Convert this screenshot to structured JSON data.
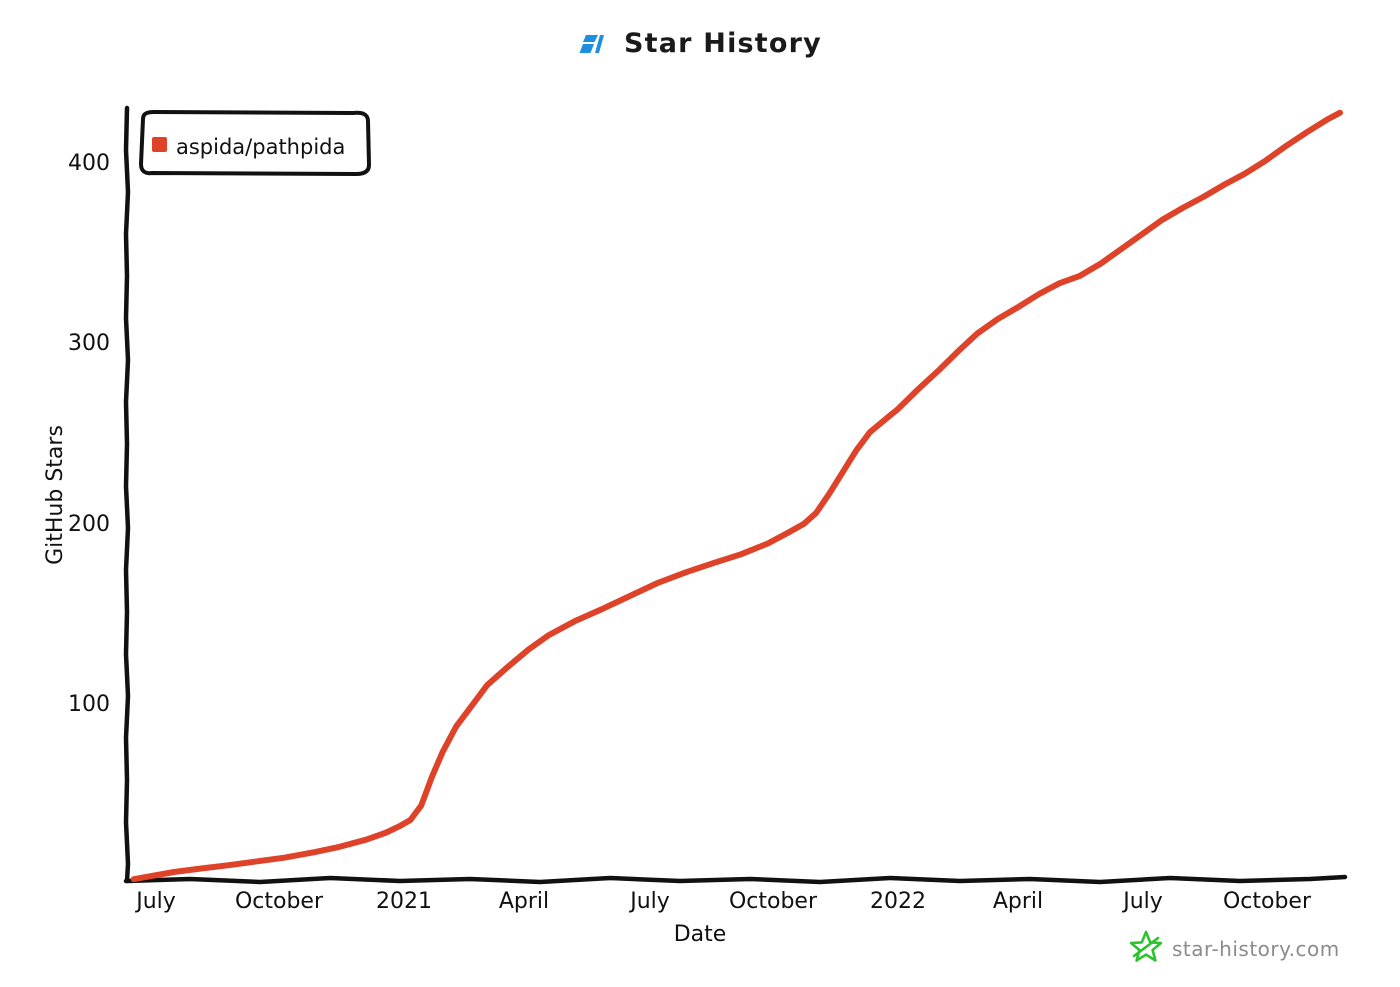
{
  "header": {
    "logo_icon": "star-history-logo-icon",
    "logo_color": "#1D8FE1",
    "title": "Star History"
  },
  "watermark": {
    "star_icon": "green-star-icon",
    "star_color": "#2EC22E",
    "text": "star-history.com"
  },
  "legend": {
    "position": "top-left",
    "entries": [
      {
        "label": "aspida/pathpida",
        "color": "#DE432A",
        "marker": "square"
      }
    ]
  },
  "chart_data": {
    "type": "line",
    "title": "Star History",
    "xlabel": "Date",
    "ylabel": "GitHub Stars",
    "grid": false,
    "xticks": [
      "July",
      "October",
      "2021",
      "April",
      "July",
      "October",
      "2022",
      "April",
      "July",
      "October"
    ],
    "yticks": [
      100,
      200,
      300,
      400
    ],
    "ylim": [
      0,
      440
    ],
    "xlim": [
      "2020-06-15",
      "2022-12-05"
    ],
    "series": [
      {
        "name": "aspida/pathpida",
        "color": "#DE432A",
        "points": [
          {
            "date": "2020-06-20",
            "stars": 1
          },
          {
            "date": "2020-07-05",
            "stars": 3
          },
          {
            "date": "2020-07-20",
            "stars": 5
          },
          {
            "date": "2020-08-10",
            "stars": 7
          },
          {
            "date": "2020-09-01",
            "stars": 9
          },
          {
            "date": "2020-09-20",
            "stars": 11
          },
          {
            "date": "2020-10-10",
            "stars": 13
          },
          {
            "date": "2020-11-01",
            "stars": 16
          },
          {
            "date": "2020-11-20",
            "stars": 19
          },
          {
            "date": "2020-12-10",
            "stars": 23
          },
          {
            "date": "2020-12-25",
            "stars": 27
          },
          {
            "date": "2021-01-05",
            "stars": 31
          },
          {
            "date": "2021-01-12",
            "stars": 34
          },
          {
            "date": "2021-01-20",
            "stars": 42
          },
          {
            "date": "2021-01-28",
            "stars": 58
          },
          {
            "date": "2021-02-05",
            "stars": 72
          },
          {
            "date": "2021-02-15",
            "stars": 86
          },
          {
            "date": "2021-02-28",
            "stars": 99
          },
          {
            "date": "2021-03-10",
            "stars": 109
          },
          {
            "date": "2021-03-25",
            "stars": 119
          },
          {
            "date": "2021-04-10",
            "stars": 129
          },
          {
            "date": "2021-04-25",
            "stars": 137
          },
          {
            "date": "2021-05-15",
            "stars": 145
          },
          {
            "date": "2021-06-05",
            "stars": 152
          },
          {
            "date": "2021-06-25",
            "stars": 159
          },
          {
            "date": "2021-07-15",
            "stars": 166
          },
          {
            "date": "2021-08-05",
            "stars": 172
          },
          {
            "date": "2021-08-25",
            "stars": 177
          },
          {
            "date": "2021-09-15",
            "stars": 182
          },
          {
            "date": "2021-10-05",
            "stars": 188
          },
          {
            "date": "2021-10-20",
            "stars": 194
          },
          {
            "date": "2021-11-01",
            "stars": 199
          },
          {
            "date": "2021-11-10",
            "stars": 205
          },
          {
            "date": "2021-11-20",
            "stars": 216
          },
          {
            "date": "2021-11-30",
            "stars": 228
          },
          {
            "date": "2021-12-10",
            "stars": 240
          },
          {
            "date": "2021-12-20",
            "stars": 250
          },
          {
            "date": "2021-12-28",
            "stars": 255
          },
          {
            "date": "2022-01-10",
            "stars": 263
          },
          {
            "date": "2022-01-25",
            "stars": 274
          },
          {
            "date": "2022-02-10",
            "stars": 285
          },
          {
            "date": "2022-02-25",
            "stars": 296
          },
          {
            "date": "2022-03-10",
            "stars": 305
          },
          {
            "date": "2022-03-25",
            "stars": 313
          },
          {
            "date": "2022-04-10",
            "stars": 320
          },
          {
            "date": "2022-04-25",
            "stars": 327
          },
          {
            "date": "2022-05-10",
            "stars": 333
          },
          {
            "date": "2022-05-25",
            "stars": 337
          },
          {
            "date": "2022-06-10",
            "stars": 344
          },
          {
            "date": "2022-06-25",
            "stars": 352
          },
          {
            "date": "2022-07-10",
            "stars": 360
          },
          {
            "date": "2022-07-25",
            "stars": 368
          },
          {
            "date": "2022-08-10",
            "stars": 375
          },
          {
            "date": "2022-08-25",
            "stars": 381
          },
          {
            "date": "2022-09-10",
            "stars": 388
          },
          {
            "date": "2022-09-25",
            "stars": 394
          },
          {
            "date": "2022-10-10",
            "stars": 401
          },
          {
            "date": "2022-10-25",
            "stars": 409
          },
          {
            "date": "2022-11-10",
            "stars": 417
          },
          {
            "date": "2022-11-25",
            "stars": 424
          },
          {
            "date": "2022-12-05",
            "stars": 428
          }
        ]
      }
    ]
  }
}
